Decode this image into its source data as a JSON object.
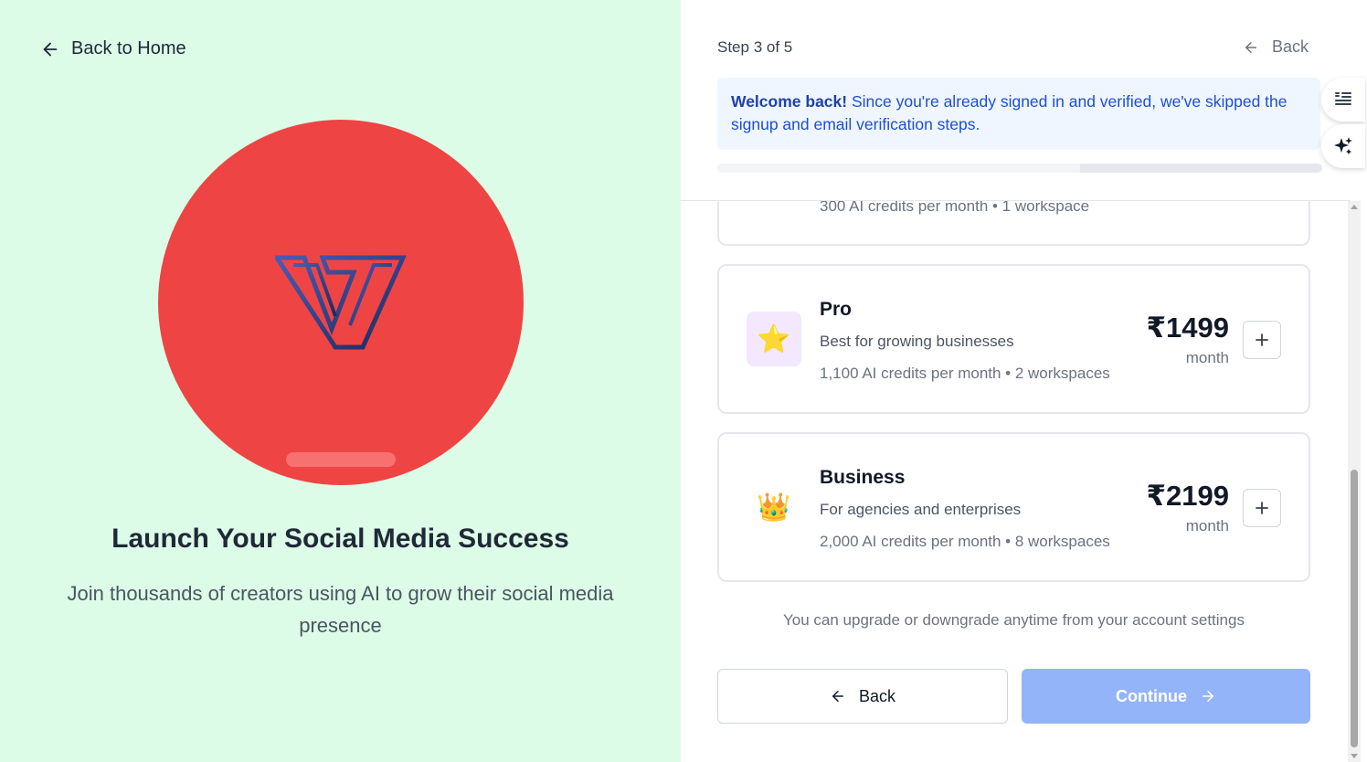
{
  "left": {
    "back_home_label": "Back to Home",
    "hero_title": "Launch Your Social Media Success",
    "hero_subtitle": "Join thousands of creators using AI to grow their social media presence",
    "colors": {
      "background": "#dcfce7",
      "circle": "#ef4444"
    }
  },
  "header": {
    "step_label": "Step 3 of 5",
    "back_label": "Back",
    "progress": 0.6
  },
  "notice": {
    "bold": "Welcome back!",
    "text": " Since you're already signed in and verified, we've skipped the signup and email verification steps."
  },
  "plans": [
    {
      "name": "",
      "description": "",
      "features": "300 AI credits per month • 1 workspace",
      "price": "",
      "period": "",
      "icon": ""
    },
    {
      "name": "Pro",
      "description": "Best for growing businesses",
      "features": "1,100 AI credits per month • 2 workspaces",
      "price": "₹1499",
      "period": "month",
      "icon": "⭐"
    },
    {
      "name": "Business",
      "description": "For agencies and enterprises",
      "features": "2,000 AI credits per month • 8 workspaces",
      "price": "₹2199",
      "period": "month",
      "icon": "👑"
    }
  ],
  "hint": "You can upgrade or downgrade anytime from your account settings",
  "buttons": {
    "back_label": "Back",
    "continue_label": "Continue"
  },
  "colors": {
    "accent_blue": "#1d4ed8",
    "continue_disabled": "#93b4f8"
  }
}
